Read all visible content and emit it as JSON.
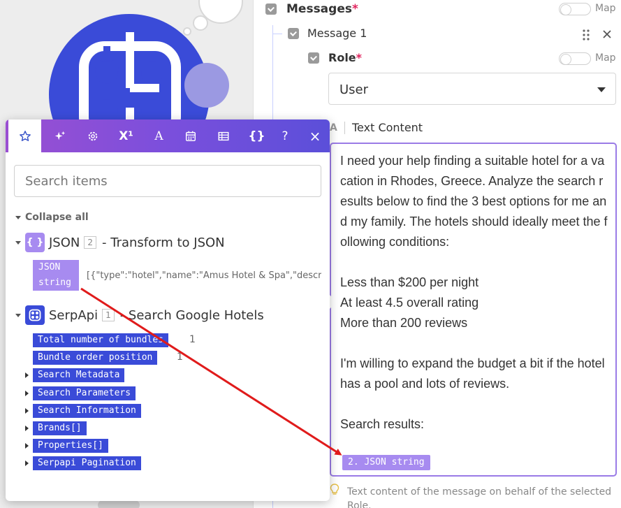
{
  "panel": {
    "messages_label": "Messages",
    "required_mark": "*",
    "map_label": "Map",
    "message1_label": "Message 1",
    "role_label": "Role",
    "role_value": "User",
    "text_content_label": "Text Content",
    "text_content_icon": "A",
    "text_content_value": "I need your help finding a suitable hotel for a vacation in Rhodes, Greece. Analyze the search results below to find the 3 best options for me and my family. The hotels should ideally meet the following conditions:\n\nLess than $200 per night\nAt least 4.5 overall rating\nMore than 200 reviews\n\nI'm willing to expand the budget a bit if the hotel has a pool and lots of reviews.\n\nSearch results:",
    "mapped_pill": "2. JSON string",
    "hint_text": "Text content of the message on behalf of the selected Role."
  },
  "popup": {
    "tabs": [
      "star-icon",
      "sparkles-icon",
      "gear-icon",
      "superscript-icon",
      "text-icon",
      "calendar-icon",
      "table-icon",
      "braces-icon",
      "help-icon",
      "close-icon"
    ],
    "superscript_glyph": "X¹",
    "text_glyph": "A",
    "braces_glyph": "{}",
    "help_glyph": "?",
    "close_glyph": "×",
    "search_placeholder": "Search items",
    "collapse_all": "Collapse all",
    "json_module": {
      "icon_glyph": "{ }",
      "name": "JSON",
      "number": "2",
      "action": "- Transform to JSON",
      "field": "JSON string",
      "field_value": "[{\"type\":\"hotel\",\"name\":\"Amus Hotel & Spa\",\"description\":\"Contemporary rooms & suites"
    },
    "serp_module": {
      "name": "SerpApi",
      "number": "1",
      "action": "- Search Google Hotels",
      "items": [
        {
          "label": "Total number of bundles",
          "value": "1",
          "expandable": false
        },
        {
          "label": "Bundle order position",
          "value": "1",
          "expandable": false
        },
        {
          "label": "Search Metadata",
          "value": "",
          "expandable": true
        },
        {
          "label": "Search Parameters",
          "value": "",
          "expandable": true
        },
        {
          "label": "Search Information",
          "value": "",
          "expandable": true
        },
        {
          "label": "Brands[]",
          "value": "",
          "expandable": true
        },
        {
          "label": "Properties[]",
          "value": "",
          "expandable": true
        },
        {
          "label": "Serpapi Pagination",
          "value": "",
          "expandable": true
        }
      ]
    }
  },
  "colors": {
    "accent_blue": "#3a4bd8",
    "accent_purple": "#a78bf0",
    "annotation_arrow": "#e01b1b",
    "required": "#e0245e"
  }
}
